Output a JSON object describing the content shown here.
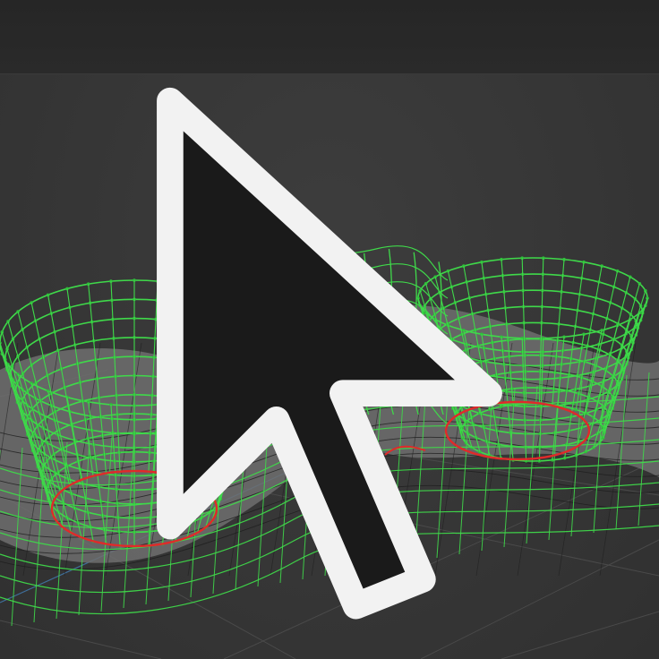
{
  "app": {
    "title": ""
  },
  "viewport": {
    "mode": "wireframe",
    "colors": {
      "background": "#363636",
      "header": "#282828",
      "grid_line": "#4a4a4a",
      "grid_axis": "#3f6e9a",
      "surface_fill": "#6e6e6e",
      "base_wire": "#1e1e1e",
      "retopo_wire": "#3fd94a",
      "retopo_vertex": "#2fbf3a",
      "boundary_edge": "#e02a2a"
    },
    "icons": {
      "cursor": "arrow-cursor-icon"
    }
  }
}
